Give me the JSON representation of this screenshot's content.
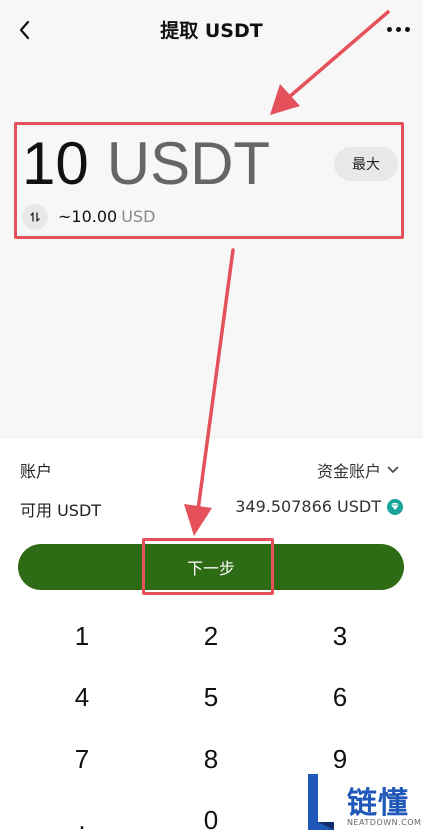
{
  "header": {
    "title": "提取 USDT"
  },
  "amount": {
    "value": "10",
    "unit": "USDT",
    "max_label": "最大",
    "converted_value": "~10.00",
    "converted_currency": "USD"
  },
  "account": {
    "label": "账户",
    "value": "资金账户"
  },
  "available": {
    "label": "可用 USDT",
    "value": "349.507866 USDT"
  },
  "next_button": {
    "label": "下一步"
  },
  "keypad": {
    "keys": [
      "1",
      "2",
      "3",
      "4",
      "5",
      "6",
      "7",
      "8",
      "9",
      ".",
      "0"
    ]
  },
  "watermark": {
    "name": "链懂",
    "domain": "NEATDOWN.COM"
  },
  "colors": {
    "accent_green": "#2d6b14",
    "annotation_red": "#e5515a",
    "gem_teal": "#1aa39a"
  }
}
